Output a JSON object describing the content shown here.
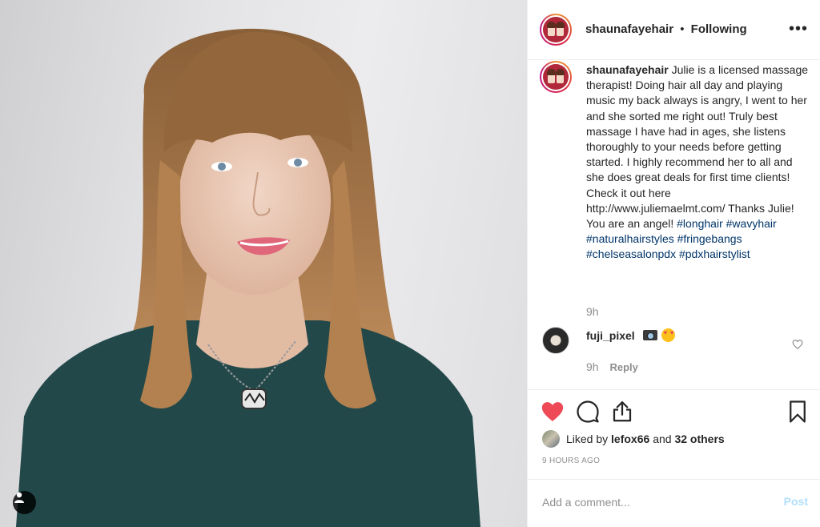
{
  "post": {
    "author": "shaunafayehair",
    "separator": "•",
    "follow_status": "Following",
    "more_label": "•••"
  },
  "caption": {
    "username": "shaunafayehair",
    "text": " Julie is a licensed massage therapist! Doing hair all day and playing music my back always is angry, I went to her and she sorted me right out! Truly best massage I have had in ages, she listens thoroughly to your needs before getting started. I highly recommend her to all and she does great deals for first time clients! Check it out here http://www.juliemaelmt.com/ Thanks Julie! You are an angel! ",
    "hashtags": [
      "#longhair",
      "#wavyhair",
      "#naturalhairstyles",
      "#fringebangs",
      "#chelseasalonpdx",
      "#pdxhairstylist"
    ],
    "time": "9h"
  },
  "comment": {
    "username": "fuji_pixel",
    "emojis": [
      "camera-with-flash",
      "heart-eyes"
    ],
    "time": "9h",
    "reply_label": "Reply"
  },
  "likes": {
    "prefix": "Liked by ",
    "user": "lefox66",
    "middle": " and ",
    "others": "32 others",
    "liked": true,
    "color": "#ed4956"
  },
  "timestamp": "9 HOURS AGO",
  "add_comment": {
    "placeholder": "Add a comment...",
    "post_label": "Post",
    "post_color": "#b2dffc"
  },
  "colors": {
    "hashtag": "#003569",
    "muted": "#8e8e8e",
    "text": "#262626",
    "border": "#efefef"
  }
}
